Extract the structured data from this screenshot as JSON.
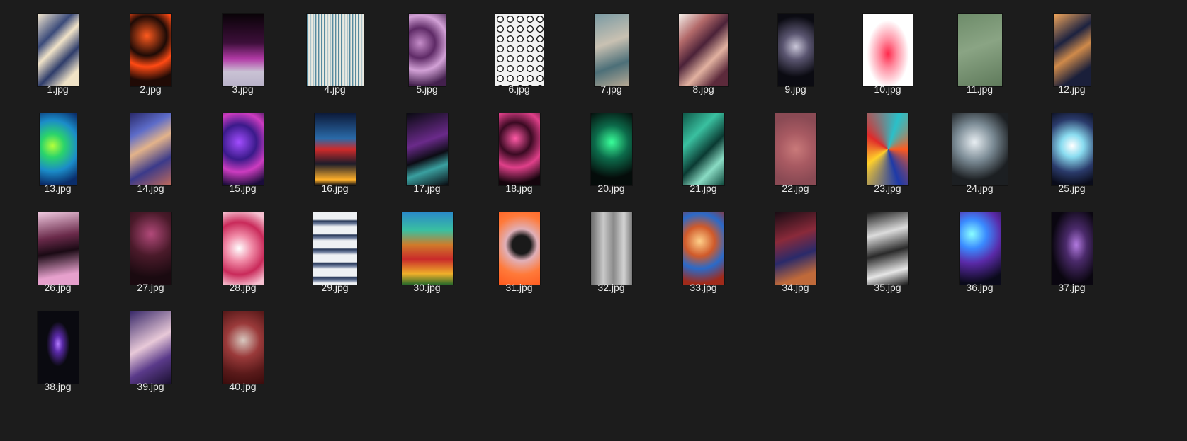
{
  "files": [
    {
      "name": "1.jpg",
      "thumb": "linear-gradient(135deg,#f2e6cf 0%,#3a4a7a 30%,#f1e3c8 45%,#2e3c6a 65%,#efe2c6 85%)"
    },
    {
      "name": "2.jpg",
      "thumb": "radial-gradient(circle at 40% 30%,#ff5a1e 0%,#1e0b06 35%,#ff4a14 55%,#200a05 80%)"
    },
    {
      "name": "3.jpg",
      "thumb": "linear-gradient(180deg,#0a0308 0%,#3d0f3a 40%,#b23aa6 62%,#c9c2d4 80%,#b9b2c9 100%)"
    },
    {
      "name": "4.jpg",
      "thumb": "repeating-linear-gradient(90deg,#2e6e88 0px,#d7e1df 2px,#f2ecdf 4px),linear-gradient(180deg,#f3ede2,#efe7d6)"
    },
    {
      "name": "5.jpg",
      "thumb": "radial-gradient(circle at 30% 40%,#c58dc9 0%,#5e2a66 30%,#d2a1d6 55%,#43204d 85%)"
    },
    {
      "name": "6.jpg",
      "thumb": "radial-gradient(circle,#ffffff 35%,#1a1a1a 38%,#1a1a1a 48%,#f2f2f2 52%)"
    },
    {
      "name": "7.jpg",
      "thumb": "linear-gradient(160deg,#7a9aa3 0%,#c9c1b2 40%,#4c6f78 70%,#b8aa95 100%)"
    },
    {
      "name": "8.jpg",
      "thumb": "linear-gradient(135deg,#f4efe9 0%,#b36a6a 25%,#4b2238 45%,#e2b2a0 65%,#5c2a3b 85%)"
    },
    {
      "name": "9.jpg",
      "thumb": "radial-gradient(circle at 50% 45%,#c9c6d8 0%,#5a5570 30%,#0b0b12 70%)"
    },
    {
      "name": "10.jpg",
      "thumb": "radial-gradient(ellipse at 50% 55%,#ff2a4c 0%,#ff8da0 25%,#ffffff 60%)"
    },
    {
      "name": "11.jpg",
      "thumb": "linear-gradient(160deg,#6e8c6a 0%,#8aa484 45%,#5f7a5b 100%)"
    },
    {
      "name": "12.jpg",
      "thumb": "linear-gradient(145deg,#f0a55b 0%,#1c2240 35%,#cf8a4a 55%,#1a1f3a 80%)"
    },
    {
      "name": "13.jpg",
      "thumb": "radial-gradient(circle at 35% 45%,#b5ff3a 0%,#2bd46a 25%,#1b8cc9 55%,#0a2d6a 85%)"
    },
    {
      "name": "14.jpg",
      "thumb": "linear-gradient(150deg,#2a2a6a 0%,#5d6cc9 25%,#e3b38a 45%,#3b3a8a 70%,#c06a5a 100%)"
    },
    {
      "name": "15.jpg",
      "thumb": "radial-gradient(circle at 40% 40%,#a24dff 0%,#3a1a8a 35%,#cc3cc0 60%,#1a0c3a 90%)"
    },
    {
      "name": "16.jpg",
      "thumb": "linear-gradient(180deg,#0c1a3a 0%,#2a6aa8 35%,#d02a2a 50%,#1c1c2a 70%,#ffb02a 92%,#0c0c12 100%)"
    },
    {
      "name": "17.jpg",
      "thumb": "linear-gradient(160deg,#0a0a12 0%,#6a2a8a 40%,#0c0c14 60%,#3aa0a0 75%,#08080e 100%)"
    },
    {
      "name": "18.jpg",
      "thumb": "radial-gradient(circle at 40% 35%,#ff5aa6 0%,#3a0a22 30%,#e0408a 55%,#14040c 85%)"
    },
    {
      "name": "20.jpg",
      "thumb": "radial-gradient(circle at 50% 40%,#3aff9a 0%,#0c6a4a 35%,#050c0a 75%)"
    },
    {
      "name": "21.jpg",
      "thumb": "linear-gradient(135deg,#0f5a4a 0%,#3ac0a0 30%,#0a3a32 55%,#8adcc4 75%,#0c463a 100%)"
    },
    {
      "name": "22.jpg",
      "thumb": "radial-gradient(circle at 50% 50%,#c97a7a 0%,#a85a62 40%,#8a4a54 80%)"
    },
    {
      "name": "23.jpg",
      "thumb": "conic-gradient(from 90deg,#ff5a1e,#1e3aa8,#ffd02a,#e02a2a,#2ac0c9,#ff5a1e)"
    },
    {
      "name": "24.jpg",
      "thumb": "radial-gradient(circle at 40% 40%,#e8eef2 0%,#7a8a94 35%,#1c1f22 70%)"
    },
    {
      "name": "25.jpg",
      "thumb": "radial-gradient(circle at 50% 45%,#ffffff 0%,#8adcf0 25%,#2a3a6a 60%,#0a0c1a 90%)"
    },
    {
      "name": "26.jpg",
      "thumb": "linear-gradient(170deg,#f0c9e0 0%,#6a2a4a 35%,#1a0a14 55%,#e6a0cc 85%)"
    },
    {
      "name": "27.jpg",
      "thumb": "radial-gradient(circle at 50% 30%,#b24a7a 0%,#4a1a2a 40%,#1a0a10 80%)"
    },
    {
      "name": "28.jpg",
      "thumb": "radial-gradient(circle at 40% 50%,#ffffff 0%,#f08aa6 30%,#c92a5a 60%,#f6c0d0 90%)"
    },
    {
      "name": "29.jpg",
      "thumb": "repeating-linear-gradient(180deg,#eef1f4 0px,#eef1f4 10px,#2a3a5a 12px,#6a7a9a 16px,#eef1f4 20px)"
    },
    {
      "name": "30.jpg",
      "thumb": "linear-gradient(180deg,#2a8ac9 0%,#3ac0a0 25%,#d07a2a 45%,#c92a2a 65%,#f0b02a 85%,#2a6a2a 100%)"
    },
    {
      "name": "31.jpg",
      "thumb": "radial-gradient(circle at 55% 45%,#1a1a1a 0%,#1a1a1a 20%,#e0b0b8 35%,#ff7a3a 65%,#ff5a1e 100%)"
    },
    {
      "name": "32.jpg",
      "thumb": "linear-gradient(90deg,#6a6a6a 0%,#c9c9c9 30%,#8a8a8a 55%,#d4d4d4 80%,#7a7a7a 100%)"
    },
    {
      "name": "33.jpg",
      "thumb": "radial-gradient(circle at 40% 40%,#ffd08a 0%,#d05a2a 30%,#2a6ac9 55%,#a02a1a 85%)"
    },
    {
      "name": "34.jpg",
      "thumb": "linear-gradient(160deg,#1a0c14 0%,#8a2a3a 35%,#2a2a6a 60%,#c06a3a 85%)"
    },
    {
      "name": "35.jpg",
      "thumb": "linear-gradient(165deg,#1a1a1a 0%,#dcdcdc 30%,#2a2a2a 55%,#e6e6e6 80%,#1a1a1a 100%)"
    },
    {
      "name": "36.jpg",
      "thumb": "radial-gradient(circle at 30% 30%,#8affff 0%,#3a8aff 25%,#5a2aa8 50%,#0a0a1a 85%)"
    },
    {
      "name": "37.jpg",
      "thumb": "radial-gradient(ellipse at 60% 45%,#b27ae0 0%,#4a2a6a 30%,#0a0610 70%)"
    },
    {
      "name": "38.jpg",
      "thumb": "radial-gradient(ellipse at 50% 45%,#b27aff 0%,#5a2aa8 15%,#0a0a10 40%)"
    },
    {
      "name": "39.jpg",
      "thumb": "linear-gradient(150deg,#3a2a6a 0%,#e8c9d8 45%,#5a3a8a 70%,#1a1030 100%)"
    },
    {
      "name": "40.jpg",
      "thumb": "radial-gradient(circle at 50% 40%,#d8c9c0 0%,#9a3a3a 35%,#5a1a1a 70%,#3a0c0c 100%)"
    }
  ]
}
